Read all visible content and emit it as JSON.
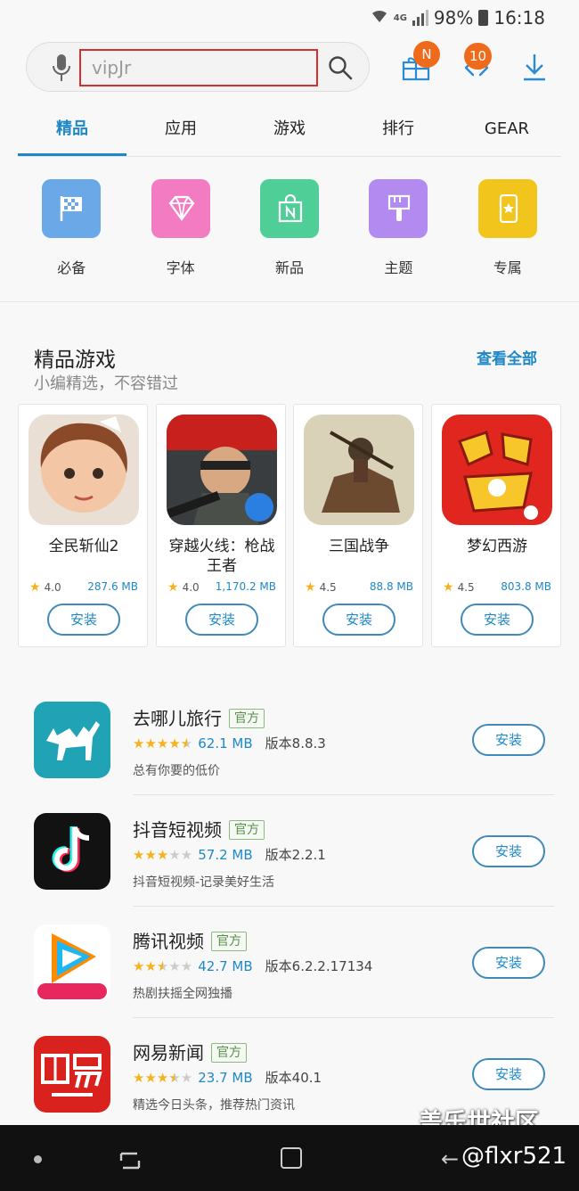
{
  "status_bar": {
    "network": "4G",
    "battery": "98%",
    "time": "16:18"
  },
  "search": {
    "value": "vipJr"
  },
  "header_badges": {
    "gift_badge": "N",
    "updates_badge": "10"
  },
  "tabs": [
    {
      "label": "精品",
      "active": true
    },
    {
      "label": "应用",
      "active": false
    },
    {
      "label": "游戏",
      "active": false
    },
    {
      "label": "排行",
      "active": false
    },
    {
      "label": "GEAR",
      "active": false
    }
  ],
  "categories": [
    {
      "label": "必备",
      "color": "#6aa8e8",
      "icon": "flag-icon"
    },
    {
      "label": "字体",
      "color": "#f27bc2",
      "icon": "diamond-icon"
    },
    {
      "label": "新品",
      "color": "#4fcf97",
      "icon": "new-bag-icon"
    },
    {
      "label": "主题",
      "color": "#b38af0",
      "icon": "brush-icon"
    },
    {
      "label": "专属",
      "color": "#f2c51c",
      "icon": "exclusive-phone-icon"
    }
  ],
  "featured": {
    "title": "精品游戏",
    "subtitle": "小编精选，不容错过",
    "view_all": "查看全部",
    "games": [
      {
        "name": "全民斩仙2",
        "rating": "4.0",
        "size": "287.6 MB",
        "install": "安装"
      },
      {
        "name": "穿越火线：枪战王者",
        "rating": "4.0",
        "size": "1,170.2 MB",
        "install": "安装"
      },
      {
        "name": "三国战争",
        "rating": "4.5",
        "size": "88.8 MB",
        "install": "安装"
      },
      {
        "name": "梦幻西游",
        "rating": "4.5",
        "size": "803.8 MB",
        "install": "安装"
      }
    ]
  },
  "apps": [
    {
      "name": "去哪儿旅行",
      "badge": "官方",
      "stars": 4.5,
      "size": "62.1 MB",
      "version": "版本8.8.3",
      "desc": "总有你要的低价",
      "install": "安装"
    },
    {
      "name": "抖音短视频",
      "badge": "官方",
      "stars": 3,
      "size": "57.2 MB",
      "version": "版本2.2.1",
      "desc": "抖音短视频-记录美好生活",
      "install": "安装"
    },
    {
      "name": "腾讯视频",
      "badge": "官方",
      "stars": 2.5,
      "size": "42.7 MB",
      "version": "版本6.2.2.17134",
      "desc": "热剧扶摇全网独播",
      "install": "安装"
    },
    {
      "name": "网易新闻",
      "badge": "官方",
      "stars": 3.5,
      "size": "23.7 MB",
      "version": "版本40.1",
      "desc": "精选今日头条，推荐热门资讯",
      "install": "安装"
    }
  ],
  "watermark": {
    "line1": "盖乐世社区",
    "line2": "@flxr521"
  }
}
